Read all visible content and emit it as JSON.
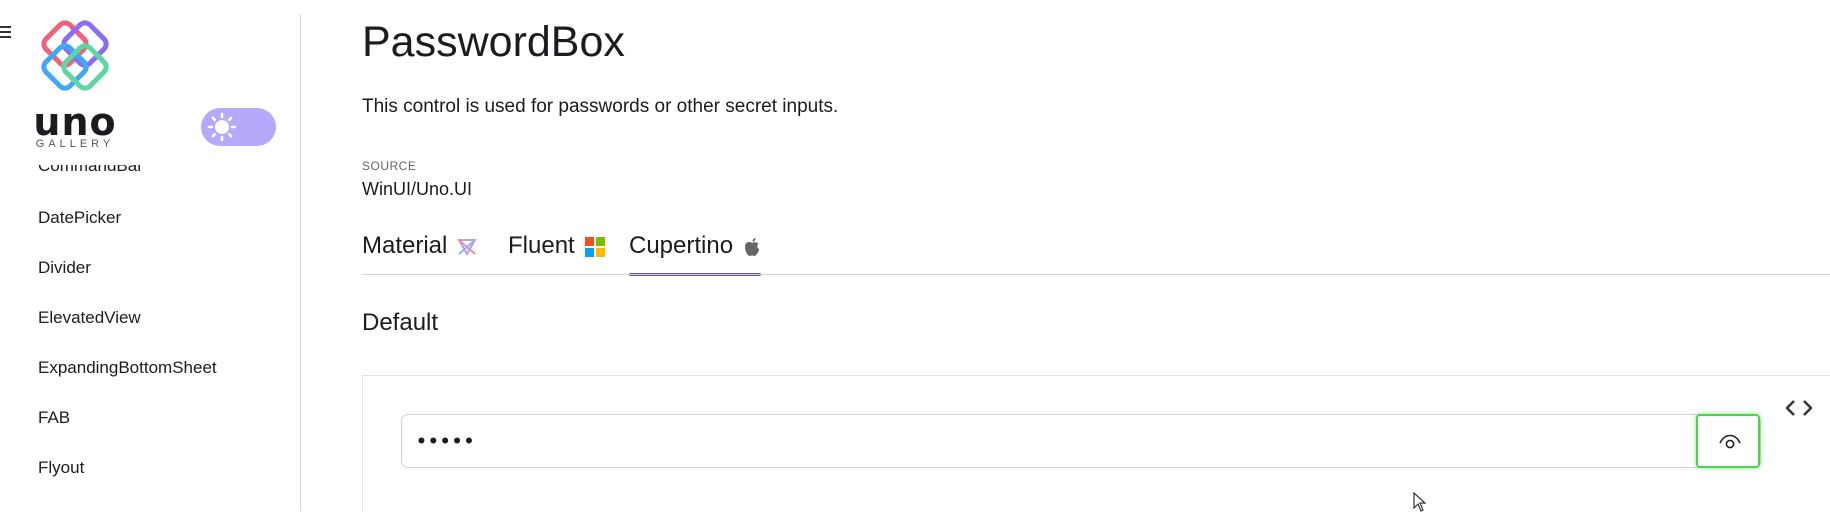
{
  "app": {
    "logo_text": "uno",
    "logo_subtext": "GALLERY"
  },
  "sidebar": {
    "items": [
      {
        "label": "CommandBar"
      },
      {
        "label": "DatePicker"
      },
      {
        "label": "Divider"
      },
      {
        "label": "ElevatedView"
      },
      {
        "label": "ExpandingBottomSheet"
      },
      {
        "label": "FAB"
      },
      {
        "label": "Flyout"
      }
    ],
    "theme_toggle_icon": "sun-icon"
  },
  "page": {
    "title": "PasswordBox",
    "description": "This control is used for passwords or other secret inputs.",
    "source_label": "SOURCE",
    "source_value": "WinUI/Uno.UI"
  },
  "tabs": [
    {
      "label": "Material",
      "icon": "material-icon"
    },
    {
      "label": "Fluent",
      "icon": "windows-icon"
    },
    {
      "label": "Cupertino",
      "icon": "apple-icon",
      "active": true
    }
  ],
  "section": {
    "title": "Default"
  },
  "password_box": {
    "value": "•••••",
    "reveal_icon": "eye-icon"
  },
  "colors": {
    "accent": "#6750a4",
    "toggle_bg": "#b5a9fb",
    "focus_outline": "#4cd44c"
  }
}
